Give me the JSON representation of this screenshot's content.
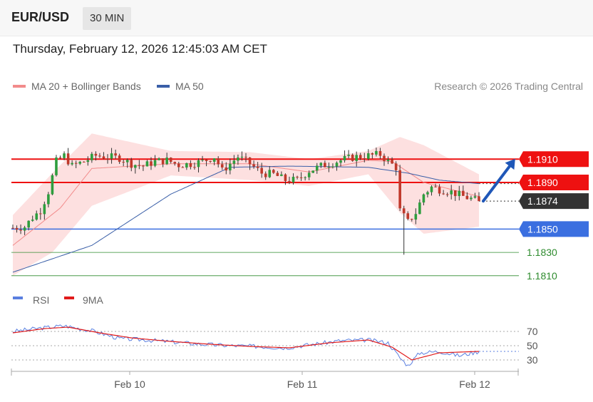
{
  "header": {
    "pair": "EUR/USD",
    "timeframe": "30 MIN",
    "datetime": "Thursday, February 12, 2026 12:45:03 AM CET"
  },
  "legend": {
    "ma20": "MA 20 + Bollinger Bands",
    "ma50": "MA 50",
    "credit": "Research © 2026 Trading Central"
  },
  "rsi_legend": {
    "rsi": "RSI",
    "ma9": "9MA"
  },
  "colors": {
    "resistance": "#ee1111",
    "support": "#3b6fe0",
    "target": "#2e8b2e",
    "last_price": "#333333",
    "arrow": "#1f57b8",
    "ma20": "#f28b8b",
    "ma50": "#3a5fa8",
    "bands": "#fde0e0",
    "rsi": "#5a7fe0",
    "rsi_ma": "#e11b1b",
    "candle_up": "#2e9e3e",
    "candle_down": "#c0392b"
  },
  "chart_data": [
    {
      "type": "candlestick",
      "title": "EUR/USD",
      "timeframe": "30 MIN",
      "x_ticks": [
        "Feb 10",
        "Feb 11",
        "Feb 12"
      ],
      "price_range": [
        1.1805,
        1.1945
      ],
      "indicators": [
        "MA 20 + Bollinger Bands",
        "MA 50"
      ],
      "levels": [
        {
          "label": "1.1910",
          "value": 1.191,
          "kind": "resistance"
        },
        {
          "label": "1.1890",
          "value": 1.189,
          "kind": "resistance"
        },
        {
          "label": "1.1874",
          "value": 1.1874,
          "kind": "last_price"
        },
        {
          "label": "1.1850",
          "value": 1.185,
          "kind": "support"
        },
        {
          "label": "1.1830",
          "value": 1.183,
          "kind": "target"
        },
        {
          "label": "1.1810",
          "value": 1.181,
          "kind": "target"
        }
      ],
      "forecast_arrow": {
        "from": 1.1874,
        "to": 1.191,
        "direction": "up"
      },
      "close_path": [
        [
          0,
          1.1851
        ],
        [
          3,
          1.1852
        ],
        [
          5,
          1.186
        ],
        [
          7,
          1.1866
        ],
        [
          9,
          1.1882
        ],
        [
          11,
          1.1908
        ],
        [
          13,
          1.1913
        ],
        [
          15,
          1.1904
        ],
        [
          18,
          1.1908
        ],
        [
          21,
          1.1913
        ],
        [
          24,
          1.1912
        ],
        [
          27,
          1.1911
        ],
        [
          30,
          1.1906
        ],
        [
          33,
          1.1904
        ],
        [
          36,
          1.1908
        ],
        [
          39,
          1.1909
        ],
        [
          42,
          1.1905
        ],
        [
          45,
          1.1906
        ],
        [
          48,
          1.1908
        ],
        [
          51,
          1.1912
        ],
        [
          53,
          1.19
        ],
        [
          55,
          1.1906
        ],
        [
          57,
          1.1912
        ],
        [
          60,
          1.1906
        ],
        [
          63,
          1.1898
        ],
        [
          66,
          1.1897
        ],
        [
          69,
          1.1892
        ],
        [
          72,
          1.1892
        ],
        [
          75,
          1.19
        ],
        [
          78,
          1.1904
        ],
        [
          81,
          1.1907
        ],
        [
          84,
          1.191
        ],
        [
          87,
          1.1912
        ],
        [
          90,
          1.1913
        ],
        [
          93,
          1.1914
        ],
        [
          95,
          1.1908
        ],
        [
          97,
          1.1903
        ],
        [
          98,
          1.1866
        ],
        [
          100,
          1.1856
        ],
        [
          102,
          1.1864
        ],
        [
          104,
          1.188
        ],
        [
          106,
          1.1886
        ],
        [
          108,
          1.1884
        ],
        [
          111,
          1.1882
        ],
        [
          114,
          1.1878
        ],
        [
          116,
          1.1876
        ],
        [
          118,
          1.1874
        ]
      ],
      "ma20_path": [
        [
          0,
          1.1836
        ],
        [
          12,
          1.1868
        ],
        [
          20,
          1.1902
        ],
        [
          40,
          1.1906
        ],
        [
          60,
          1.1906
        ],
        [
          75,
          1.1899
        ],
        [
          90,
          1.1909
        ],
        [
          96,
          1.1908
        ],
        [
          104,
          1.189
        ],
        [
          118,
          1.1878
        ]
      ],
      "ma50_path": [
        [
          0,
          1.1813
        ],
        [
          20,
          1.1836
        ],
        [
          40,
          1.188
        ],
        [
          55,
          1.1903
        ],
        [
          70,
          1.1904
        ],
        [
          90,
          1.1903
        ],
        [
          100,
          1.1898
        ],
        [
          108,
          1.1892
        ],
        [
          118,
          1.1889
        ]
      ],
      "bollinger_upper": [
        [
          0,
          1.1862
        ],
        [
          10,
          1.1898
        ],
        [
          20,
          1.1932
        ],
        [
          40,
          1.1917
        ],
        [
          60,
          1.1916
        ],
        [
          75,
          1.191
        ],
        [
          90,
          1.1917
        ],
        [
          98,
          1.1929
        ],
        [
          104,
          1.1922
        ],
        [
          118,
          1.1897
        ]
      ],
      "bollinger_lower": [
        [
          0,
          1.181
        ],
        [
          10,
          1.183
        ],
        [
          20,
          1.187
        ],
        [
          40,
          1.1896
        ],
        [
          60,
          1.1892
        ],
        [
          75,
          1.1887
        ],
        [
          90,
          1.1897
        ],
        [
          98,
          1.1864
        ],
        [
          104,
          1.1846
        ],
        [
          118,
          1.1852
        ]
      ]
    },
    {
      "type": "line",
      "title": "RSI",
      "y_ticks": [
        70,
        50,
        30
      ],
      "x_ticks": [
        "Feb 10",
        "Feb 11",
        "Feb 12"
      ],
      "series": [
        {
          "name": "RSI",
          "values": [
            [
              0,
              70
            ],
            [
              6,
              74
            ],
            [
              13,
              78
            ],
            [
              20,
              71
            ],
            [
              27,
              60
            ],
            [
              34,
              58
            ],
            [
              41,
              55
            ],
            [
              48,
              52
            ],
            [
              55,
              50
            ],
            [
              62,
              49
            ],
            [
              69,
              47
            ],
            [
              76,
              52
            ],
            [
              83,
              57
            ],
            [
              90,
              58
            ],
            [
              95,
              54
            ],
            [
              98,
              33
            ],
            [
              100,
              22
            ],
            [
              103,
              40
            ],
            [
              108,
              42
            ],
            [
              113,
              36
            ],
            [
              118,
              42
            ]
          ]
        },
        {
          "name": "9MA",
          "values": [
            [
              0,
              68
            ],
            [
              8,
              74
            ],
            [
              14,
              76
            ],
            [
              22,
              68
            ],
            [
              30,
              61
            ],
            [
              40,
              56
            ],
            [
              50,
              52
            ],
            [
              60,
              49
            ],
            [
              70,
              47
            ],
            [
              80,
              54
            ],
            [
              90,
              58
            ],
            [
              96,
              48
            ],
            [
              101,
              30
            ],
            [
              108,
              40
            ],
            [
              118,
              42
            ]
          ]
        }
      ],
      "last_value": 42
    }
  ]
}
